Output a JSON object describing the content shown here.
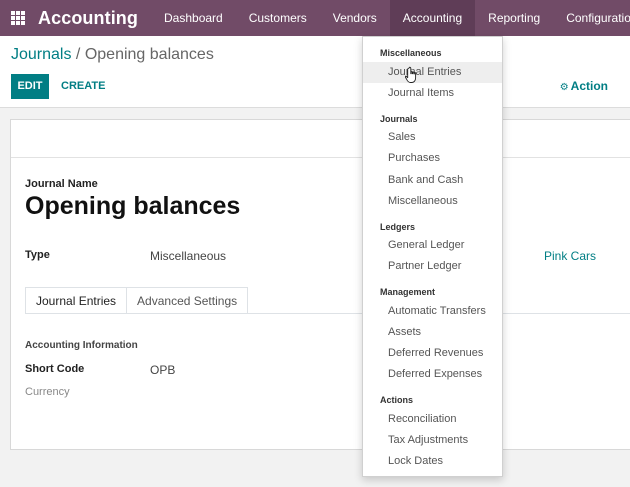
{
  "navbar": {
    "brand": "Accounting",
    "items": [
      "Dashboard",
      "Customers",
      "Vendors",
      "Accounting",
      "Reporting",
      "Configuration"
    ],
    "active_index": 3,
    "bg_color": "#714b67"
  },
  "control_panel": {
    "breadcrumb_parent": "Journals",
    "breadcrumb_separator": " / ",
    "breadcrumb_current": "Opening balances",
    "edit_label": "EDIT",
    "create_label": "CREATE",
    "action_icon": "gear-icon",
    "action_label": "Action"
  },
  "form": {
    "journal_name_label": "Journal Name",
    "journal_name": "Opening balances",
    "type_label": "Type",
    "type_value": "Miscellaneous",
    "company_value": "Pink Cars",
    "tabs": [
      "Journal Entries",
      "Advanced Settings"
    ],
    "section_title": "Accounting Information",
    "short_code_label": "Short Code",
    "short_code_value": "OPB",
    "currency_label": "Currency"
  },
  "menu": {
    "sections": [
      {
        "title": "Miscellaneous",
        "items": [
          "Journal Entries",
          "Journal Items"
        ]
      },
      {
        "title": "Journals",
        "items": [
          "Sales",
          "Purchases",
          "Bank and Cash",
          "Miscellaneous"
        ]
      },
      {
        "title": "Ledgers",
        "items": [
          "General Ledger",
          "Partner Ledger"
        ]
      },
      {
        "title": "Management",
        "items": [
          "Automatic Transfers",
          "Assets",
          "Deferred Revenues",
          "Deferred Expenses"
        ]
      },
      {
        "title": "Actions",
        "items": [
          "Reconciliation",
          "Tax Adjustments",
          "Lock Dates"
        ]
      }
    ],
    "hovered_item": "Journal Entries"
  },
  "colors": {
    "accent": "#017e84",
    "navbar": "#714b67",
    "navbar_active": "#5f3d57"
  }
}
